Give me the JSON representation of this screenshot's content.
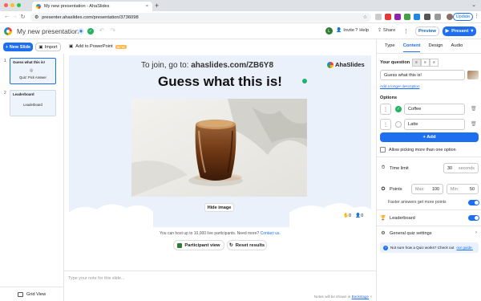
{
  "browser": {
    "tab_title": "My new presentation - AhaSlides",
    "url": "presenter.ahaslides.com/presentation/3736098",
    "update_label": "Update"
  },
  "header": {
    "title": "My new presentation",
    "invite": "Invite",
    "help": "Help",
    "share": "Share",
    "preview": "Preview",
    "present": "Present",
    "avatar_initial": "L"
  },
  "toolbar": {
    "new_slide": "+ New Slide",
    "import": "Import",
    "add_ppt": "Add to PowerPoint",
    "beta": "BETA"
  },
  "slides": [
    {
      "num": "1",
      "title": "Guess what this is!",
      "label": "Quiz: Pick Answer"
    },
    {
      "num": "2",
      "title": "Leaderboard",
      "label": "Leaderboard"
    }
  ],
  "grid_view": "Grid View",
  "canvas": {
    "join_prefix": "To join, go to: ",
    "join_url": "ahaslides.com/ZB6Y8",
    "brand": "AhaSlides",
    "question": "Guess what this is!",
    "hide_image": "Hide image",
    "stat_answers": "0",
    "stat_people": "0"
  },
  "host_note": {
    "text": "You can host up to 10,000 live participants. Need more?",
    "link": "Contact us."
  },
  "actions": {
    "participant_view": "Participant view",
    "reset_results": "Reset results"
  },
  "notes": {
    "placeholder": "Type your note for this slide...",
    "footer": "Notes will be shown in",
    "footer_link": "Backstage"
  },
  "panel": {
    "tabs": [
      "Type",
      "Content",
      "Design",
      "Audio"
    ],
    "your_question": "Your question",
    "question_value": "Guess what this is!",
    "add_longer": "Add a longer description",
    "options_label": "Options",
    "options": [
      {
        "text": "Coffee",
        "correct": true
      },
      {
        "text": "Latte",
        "correct": false
      }
    ],
    "add": "+ Add",
    "allow_multi": "Allow picking more than one option",
    "time_limit": "Time limit",
    "time_value": "30",
    "time_unit": "seconds",
    "points": "Points",
    "max_label": "Max:",
    "max_value": "100",
    "min_label": "Min:",
    "min_value": "50",
    "faster": "Faster answers get more points",
    "leaderboard": "Leaderboard",
    "general": "General quiz settings",
    "help_text": "Not sure how a Quiz works? Check out",
    "help_link": "our guide."
  },
  "colors": {
    "accent": "#1e6ff0",
    "correct": "#22b35e",
    "canvas_bg": "#eaf1fb"
  }
}
